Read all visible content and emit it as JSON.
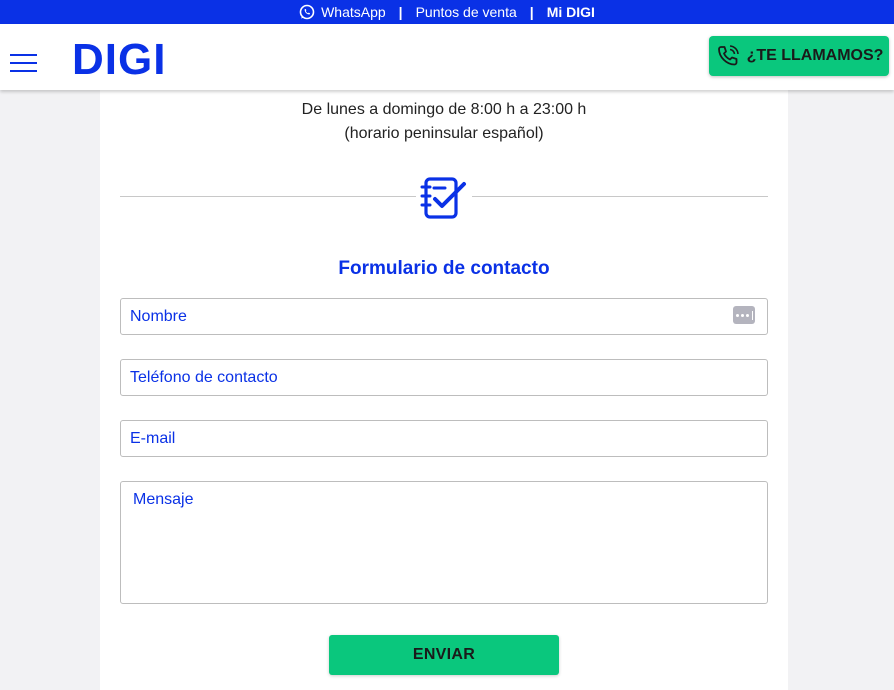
{
  "topbar": {
    "whatsapp_label": "WhatsApp",
    "puntos_label": "Puntos de venta",
    "midigi_label": "Mi DIGI",
    "separator": "|"
  },
  "header": {
    "logo_text": "DIGI",
    "call_button_label": "¿TE LLAMAMOS?"
  },
  "schedule": {
    "line1": "De lunes a domingo de 8:00 h a 23:00 h",
    "line2": "(horario peninsular español)"
  },
  "form": {
    "title": "Formulario de contacto",
    "name_placeholder": "Nombre",
    "phone_placeholder": "Teléfono de contacto",
    "email_placeholder": "E-mail",
    "message_placeholder": "Mensaje",
    "submit_label": "ENVIAR"
  },
  "colors": {
    "brand_blue": "#0a31e6",
    "brand_green": "#0ac77d",
    "background": "#f2f2f4"
  },
  "icons": {
    "whatsapp": "whatsapp-icon",
    "menu": "hamburger-menu-icon",
    "phone": "phone-ringing-icon",
    "form": "notebook-checkmark-icon",
    "autofill": "autofill-dots-icon"
  }
}
